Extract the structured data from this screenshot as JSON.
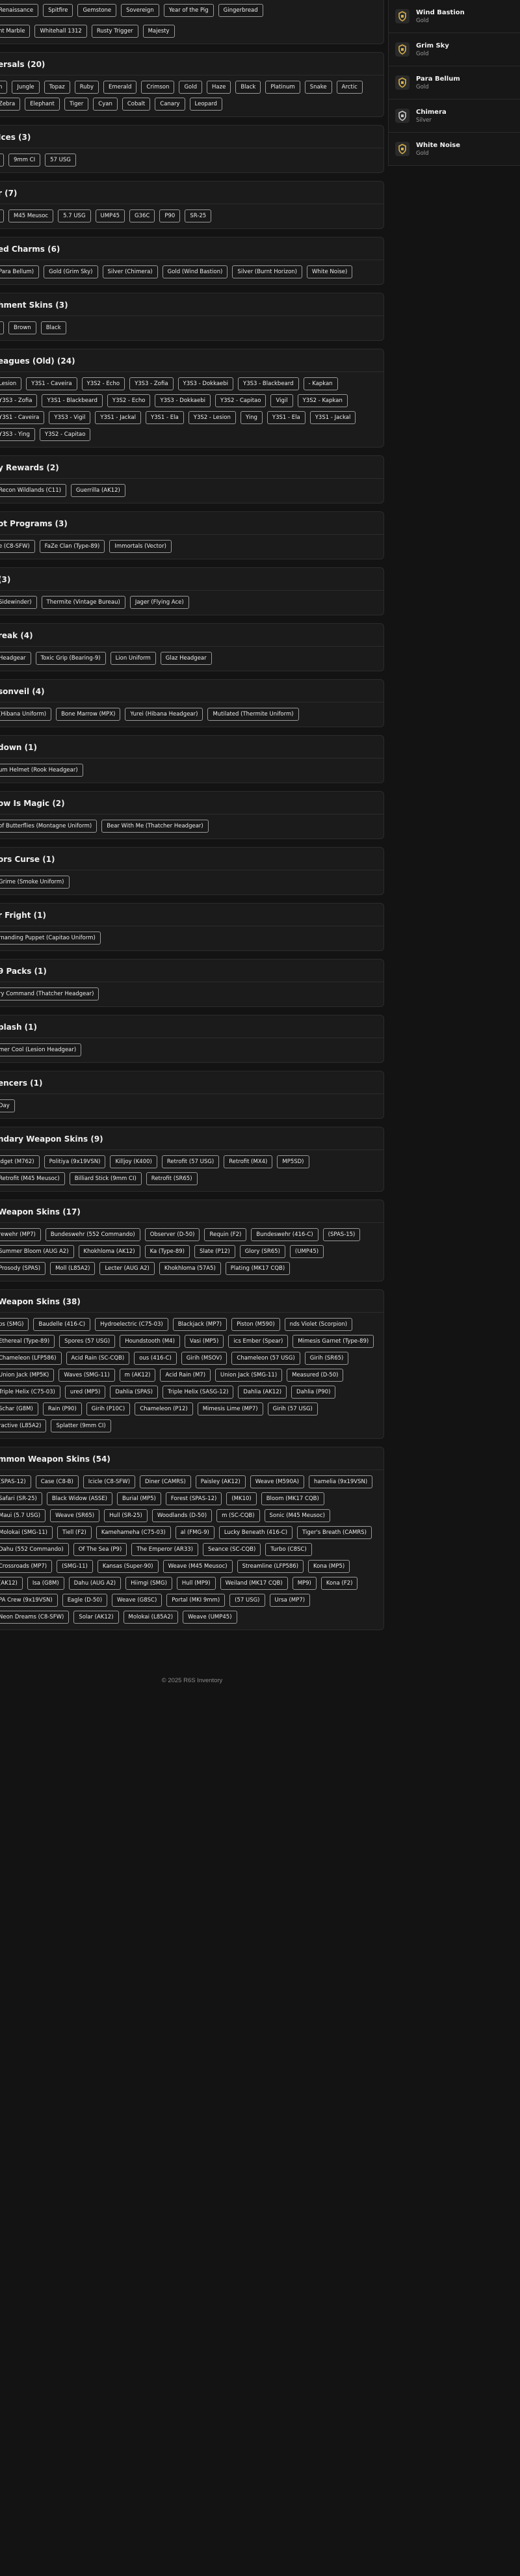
{
  "top_fragment": {
    "rows": [
      [
        "Renaissance",
        "Spitfire",
        "Gemstone",
        "Sovereign",
        "Year of the Pig",
        "Gingerbread"
      ],
      [
        "nt Marble",
        "Whitehall 1312",
        "Rusty Trigger",
        "Majesty"
      ]
    ]
  },
  "sections": [
    {
      "title": "ersals (20)",
      "items": [
        "n",
        "Jungle",
        "Topaz",
        "Ruby",
        "Emerald",
        "Crimson",
        "Gold",
        "Haze",
        "Black",
        "Platinum",
        "Snake",
        "Arctic",
        "Zebra",
        "Elephant",
        "Tiger",
        "Cyan",
        "Cobalt",
        "Canary",
        "Leopard"
      ]
    },
    {
      "title": "Ices (3)",
      "items": [
        "",
        "9mm CI",
        "57 USG"
      ]
    },
    {
      "title": "r (7)",
      "items": [
        "",
        "M45 Meusoc",
        "5.7 USG",
        "UMP45",
        "G36C",
        "P90",
        "SR-25"
      ]
    },
    {
      "title": "ed Charms (6)",
      "items": [
        "Para Bellum)",
        "Gold (Grim Sky)",
        "Silver (Chimera)",
        "Gold (Wind Bastion)",
        "Silver (Burnt Horizon)",
        "White Noise)"
      ]
    },
    {
      "title": "hment Skins (3)",
      "items": [
        "",
        "Brown",
        "Black"
      ]
    },
    {
      "title": "eagues (Old) (24)",
      "items": [
        "Lesion",
        "Y3S1 - Caveira",
        "Y3S2 - Echo",
        "Y3S3 - Zofia",
        "Y3S3 - Dokkaebi",
        "Y3S3 - Blackbeard",
        "- Kapkan",
        "Y3S3 - Zofia",
        "Y3S1 - Blackbeard",
        "Y3S2 - Echo",
        "Y3S3 - Dokkaebi",
        "Y3S2 - Capitao",
        "Vigil",
        "Y3S2 - Kapkan",
        "Y3S1 - Caveira",
        "Y3S3 - Vigil",
        "Y3S1 - Jackal",
        "Y3S1 - Ela",
        "Y3S2 - Lesion",
        "Ying",
        "Y3S1 - Ela",
        "Y3S1 - Jackal",
        "Y3S3 - Ying",
        "Y3S2 - Capitao"
      ]
    },
    {
      "title": "y Rewards (2)",
      "items": [
        "Recon Wildlands (C11)",
        "Guerrilla (AK12)"
      ]
    },
    {
      "title": "ot Programs (3)",
      "items": [
        "e (C8-SFW)",
        "FaZe Clan (Type-89)",
        "Immortals (Vector)"
      ]
    },
    {
      "title": "(3)",
      "items": [
        "Sidewinder)",
        "Thermite (Vintage Bureau)",
        "Jager (Flying Ace)"
      ]
    },
    {
      "title": "reak (4)",
      "items": [
        "Headgear",
        "Toxic Grip (Bearing-9)",
        "Lion Uniform",
        "Glaz Headgear"
      ]
    },
    {
      "title": "sonveil (4)",
      "items": [
        "(Hibana Uniform)",
        "Bone Marrow (MPX)",
        "Yurei (Hibana Headgear)",
        "Mutilated (Thermite Uniform)"
      ]
    },
    {
      "title": "down (1)",
      "items": [
        "um Helmet (Rook Headgear)"
      ]
    },
    {
      "title": "ow Is Magic (2)",
      "items": [
        "of Butterflies (Montagne Uniform)",
        "Bear With Me (Thatcher Headgear)"
      ]
    },
    {
      "title": "ors Curse (1)",
      "items": [
        "Grime (Smoke Uniform)"
      ]
    },
    {
      "title": "r Fright (1)",
      "items": [
        "rnanding Puppet (Capitao Uniform)"
      ]
    },
    {
      "title": "9 Packs (1)",
      "items": [
        "ry Command (Thatcher Headgear)"
      ]
    },
    {
      "title": "plash (1)",
      "items": [
        "mer Cool (Lesion Headgear)"
      ]
    },
    {
      "title": "encers (1)",
      "items": [
        "Day"
      ]
    },
    {
      "title": "ndary Weapon Skins (9)",
      "items": [
        "idget (M762)",
        "Politiya (9x19VSN)",
        "Killjoy (K400)",
        "Retrofit (57 USG)",
        "Retrofit (MX4)",
        "MP5SD)",
        "Retrofit (M45 Meusoc)",
        "Billiard Stick (9mm CI)",
        "Retrofit (SR65)"
      ]
    },
    {
      "title": "Weapon Skins (17)",
      "items": [
        "rewehr (MP7)",
        "Bundeswehr (552 Commando)",
        "Observer (D-50)",
        "Requin (F2)",
        "Bundeswehr (416-C)",
        "(SPAS-15)",
        "Summer Bloom (AUG A2)",
        "Khokhloma (AK12)",
        "Ka (Type-89)",
        "Slate (P12)",
        "Glory (SR65)",
        "(UMP45)",
        "Prosody (SPAS)",
        "Moll (L85A2)",
        "Lecter (AUG A2)",
        "Khokhloma (57A5)",
        "Plating (MK17 CQB)"
      ]
    },
    {
      "title": "Weapon Skins (38)",
      "items": [
        "ps (SMG)",
        "Baudelle (416-C)",
        "Hydroelectric (C75-03)",
        "Blackjack (MP7)",
        "Piston (M590)",
        "nds Violet (Scorpion)",
        "Ethereal (Type-89)",
        "Spores (57 USG)",
        "Houndstooth (M4)",
        "Vasi (MP5)",
        "ics Ember (Spear)",
        "Mimesis Garnet (Type-89)",
        "Chameleon (LFP586)",
        "Acid Rain (SC-CQB)",
        "ous (416-C)",
        "Girih (MSOV)",
        "Chameleon (57 USG)",
        "Girih (SR65)",
        "Union Jack (MP5K)",
        "Waves (SMG-11)",
        "m (AK12)",
        "Acid Rain (M7)",
        "Union Jack (SMG-11)",
        "Measured (D-50)",
        "Triple Helix (C75-03)",
        "ured (MP5)",
        "Dahlia (SPAS)",
        "Triple Helix (SASG-12)",
        "Dahlia (AK12)",
        "Dahlia (P90)",
        "Schar (G8M)",
        "Rain (P90)",
        "Girih (P10C)",
        "Chameleon (P12)",
        "Mimesis Lime (MP7)",
        "Girih (57 USG)",
        "ractive (L85A2)",
        "Splatter (9mm CI)"
      ]
    },
    {
      "title": "mmon Weapon Skins (54)",
      "items": [
        "(SPAS-12)",
        "Case (C8-B)",
        "Icicle (C8-SFW)",
        "Diner (CAMRS)",
        "Paisley (AK12)",
        "Weave (M590A)",
        "hamelia (9x19VSN)",
        "Safari (SR-25)",
        "Black Widow (ASSE)",
        "Burial (MP5)",
        "Forest (SPAS-12)",
        "(MK10)",
        "Bloom (MK17 CQB)",
        "Maui (5.7 USG)",
        "Weave (SR65)",
        "Hull (SR-25)",
        "Woodlands (D-50)",
        "m (SC-CQB)",
        "Sonic (M45 Meusoc)",
        "Molokai (SMG-11)",
        "Tiell (F2)",
        "Kamehameha (C75-03)",
        "al (FMG-9)",
        "Lucky Beneath (416-C)",
        "Tiger's Breath (CAMRS)",
        "Dahu (552 Commando)",
        "Of The Sea (P9)",
        "The Emperor (AR33)",
        "Seance (SC-CQB)",
        "Turbo (C8SC)",
        "Crossroads (MP7)",
        "(SMG-11)",
        "Kansas (Super-90)",
        "Weave (M45 Meusoc)",
        "Streamline (LFP586)",
        "Kona (MP5)",
        "(AK12)",
        "Isa (G8M)",
        "Dahu (AUG A2)",
        "Hiimgi (SMG)",
        "Hull (MP9)",
        "Weiland (MK17 CQB)",
        "MP9)",
        "Kona (F2)",
        "PA Crew (9x19VSN)",
        "Eagle (D-50)",
        "Weave (G8SC)",
        "Portal (MKI 9mm)",
        "(57 USG)",
        "Ursa (MP7)",
        "Neon Dreams (C8-SFW)",
        "Solar (AK12)",
        "Molokai (L85A2)",
        "Weave (UMP45)"
      ]
    }
  ],
  "sidebar": {
    "items": [
      {
        "name": "Wind Bastion",
        "tier": "Gold"
      },
      {
        "name": "Grim Sky",
        "tier": "Gold"
      },
      {
        "name": "Para Bellum",
        "tier": "Gold"
      },
      {
        "name": "Chimera",
        "tier": "Silver"
      },
      {
        "name": "White Noise",
        "tier": "Gold"
      }
    ]
  },
  "footer": {
    "text": "© 2025 R6S Inventory"
  },
  "colors": {
    "background": "#131313",
    "card": "#1b1b1b",
    "chip_border": "#9a9a9a",
    "badge_gold": "#d7b24a",
    "badge_silver": "#c8c8c8"
  }
}
